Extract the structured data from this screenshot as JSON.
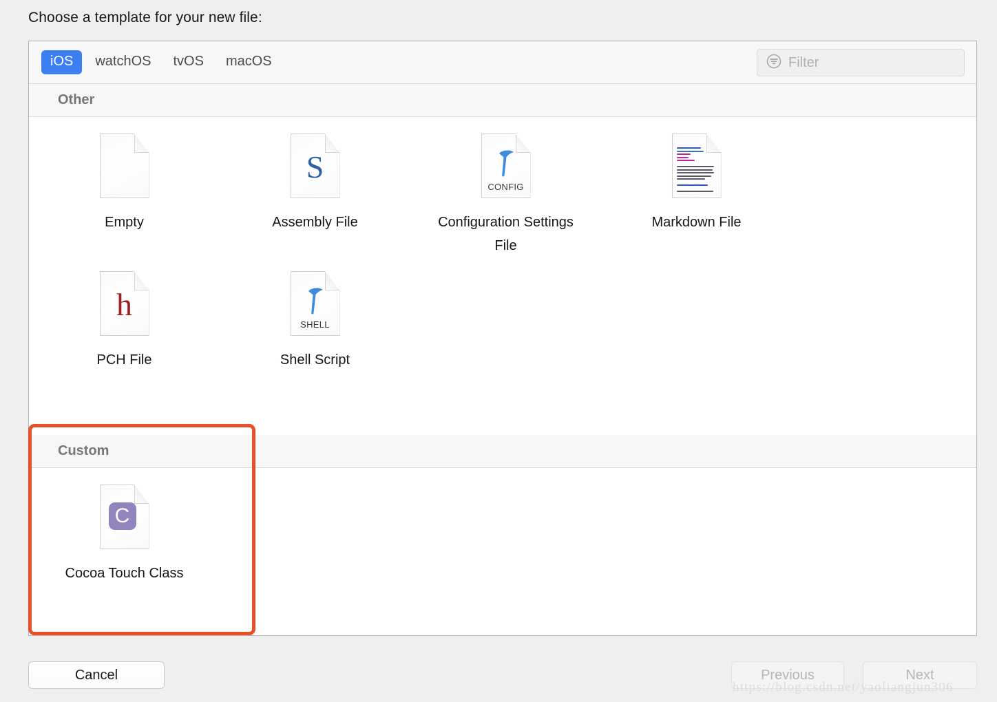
{
  "dialog": {
    "title": "Choose a template for your new file:"
  },
  "toolbar": {
    "tabs": [
      {
        "label": "iOS",
        "selected": true
      },
      {
        "label": "watchOS",
        "selected": false
      },
      {
        "label": "tvOS",
        "selected": false
      },
      {
        "label": "macOS",
        "selected": false
      }
    ],
    "filter": {
      "placeholder": "Filter",
      "value": "",
      "icon": "filter-icon"
    },
    "accent_color": "#3b7ff2"
  },
  "sections": [
    {
      "header": "Other",
      "templates": [
        {
          "label": "Empty",
          "icon": "blank-page-icon",
          "glyph": ""
        },
        {
          "label": "Assembly File",
          "icon": "assembly-file-icon",
          "glyph": "S",
          "glyph_color": "#2f5f9e"
        },
        {
          "label": "Configuration Settings File",
          "icon": "config-settings-file-icon",
          "glyph": "hammer",
          "sub": "CONFIG",
          "glyph_color": "#3d8ce0"
        },
        {
          "label": "Markdown File",
          "icon": "markdown-file-icon",
          "glyph": "text-preview"
        },
        {
          "label": "PCH File",
          "icon": "pch-file-icon",
          "glyph": "h",
          "glyph_color": "#9c2224"
        },
        {
          "label": "Shell Script",
          "icon": "shell-script-icon",
          "glyph": "hammer",
          "sub": "SHELL",
          "glyph_color": "#3d8ce0"
        }
      ]
    },
    {
      "header": "Custom",
      "templates": [
        {
          "label": "Cocoa Touch Class",
          "icon": "cocoa-touch-class-icon",
          "glyph": "C",
          "glyph_color": "#9284bc"
        }
      ]
    }
  ],
  "annotation": {
    "color": "#e8502a",
    "target": "Custom"
  },
  "footer": {
    "cancel_label": "Cancel",
    "previous_label": "Previous",
    "next_label": "Next",
    "previous_enabled": false,
    "next_enabled": false
  },
  "watermark": {
    "text": "https://blog.csdn.net/yaoliangjun306"
  }
}
